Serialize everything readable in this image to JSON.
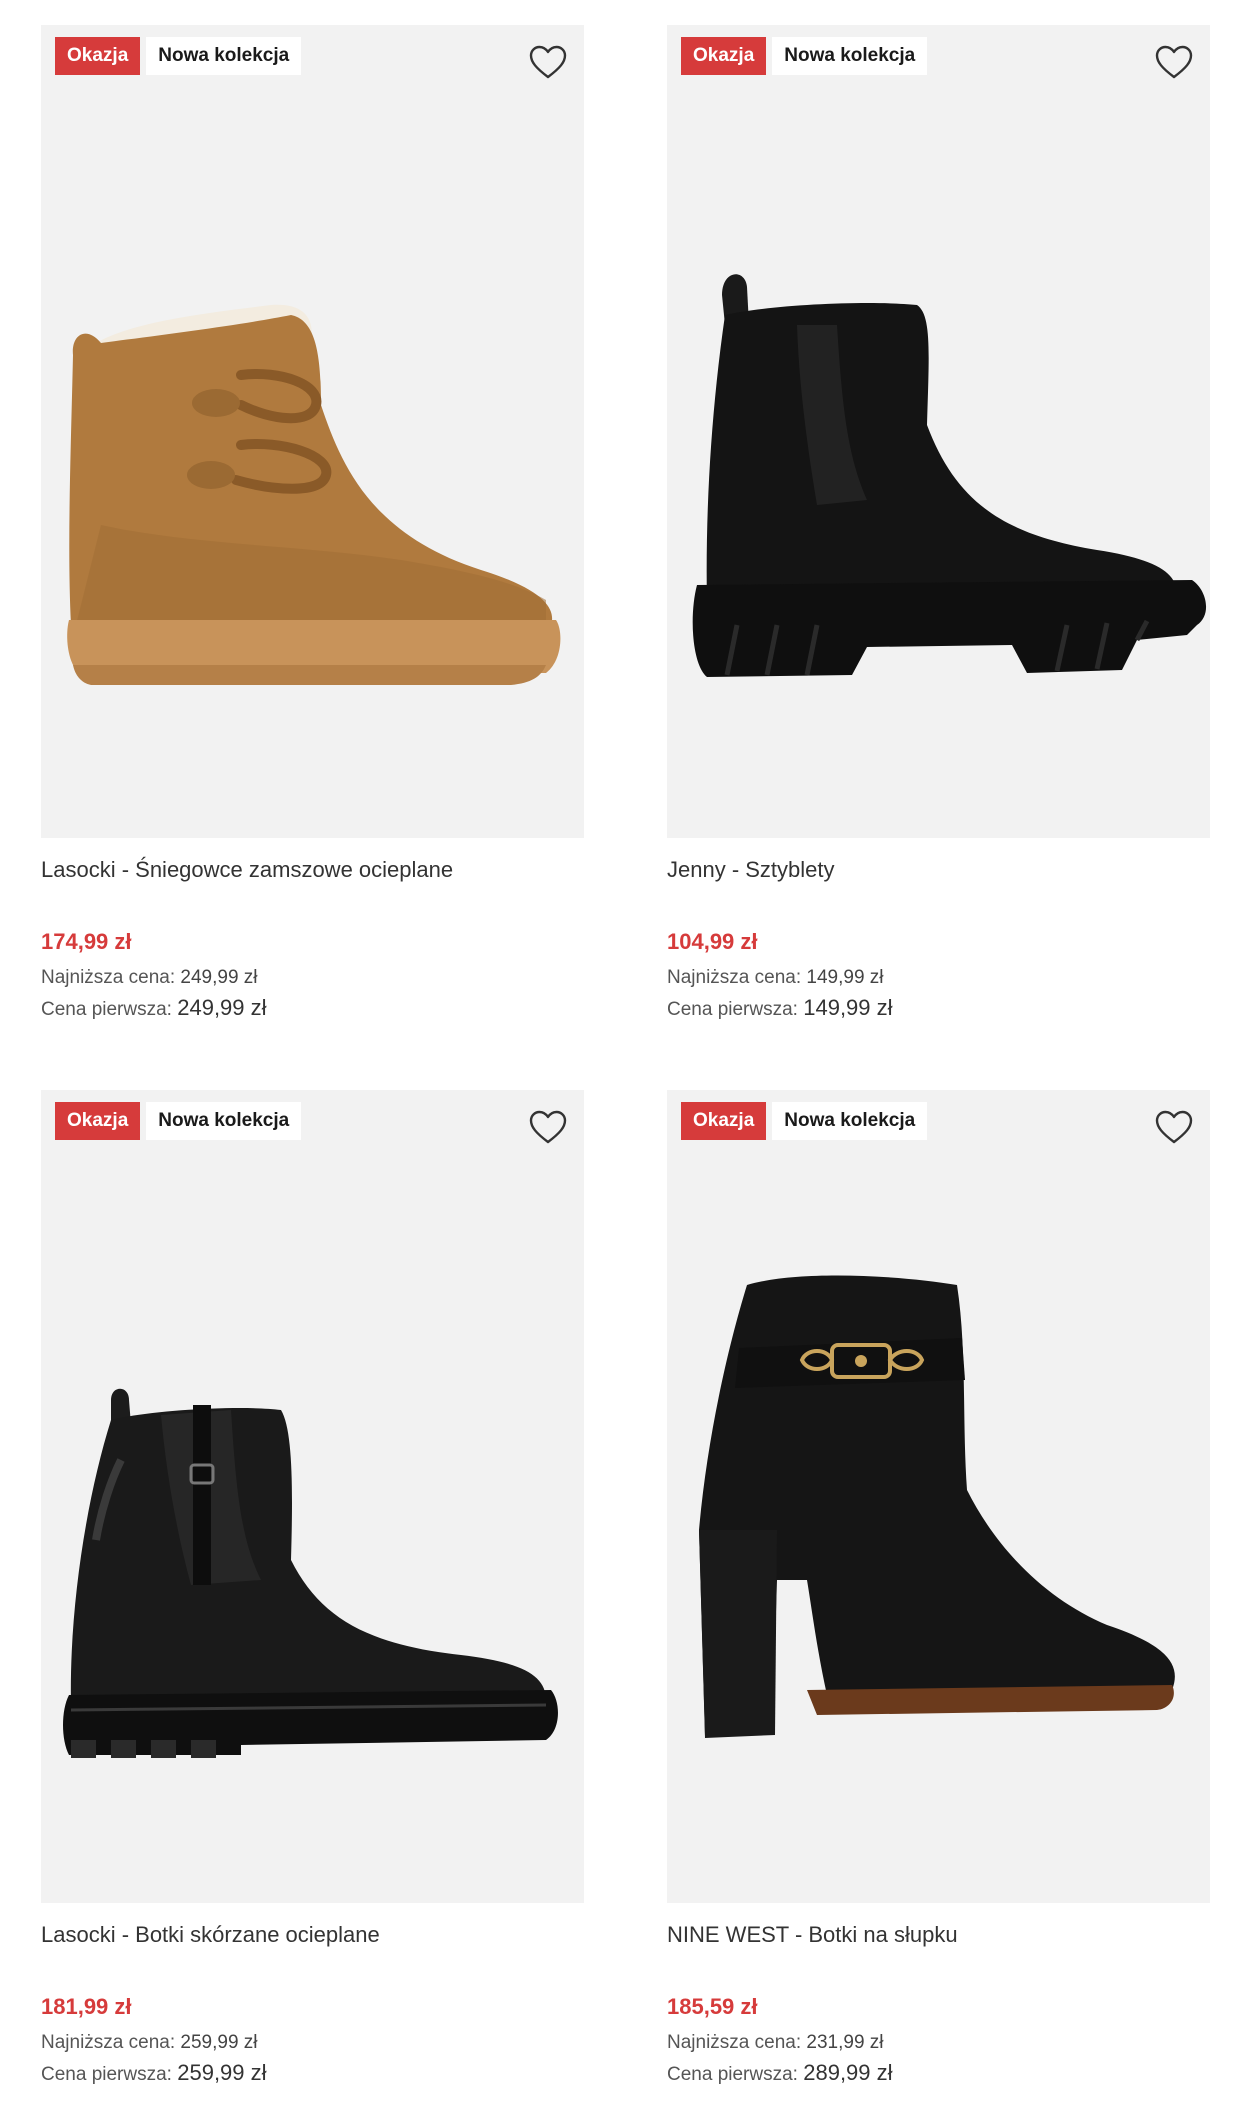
{
  "products": [
    {
      "badge_deal": "Okazja",
      "badge_new": "Nowa kolekcja",
      "title": "Lasocki - Śniegowce zamszowe ocieplane",
      "price": "174,99 zł",
      "lowest_label": "Najniższa cena:",
      "lowest_value": "249,99 zł",
      "first_label": "Cena pierwsza:",
      "first_value": "249,99 zł",
      "image": "tan-suede-snow-boot"
    },
    {
      "badge_deal": "Okazja",
      "badge_new": "Nowa kolekcja",
      "title": "Jenny - Sztyblety",
      "price": "104,99 zł",
      "lowest_label": "Najniższa cena:",
      "lowest_value": "149,99 zł",
      "first_label": "Cena pierwsza:",
      "first_value": "149,99 zł",
      "image": "black-chelsea-boot-lug-sole"
    },
    {
      "badge_deal": "Okazja",
      "badge_new": "Nowa kolekcja",
      "title": "Lasocki - Botki skórzane ocieplane",
      "price": "181,99 zł",
      "lowest_label": "Najniższa cena:",
      "lowest_value": "259,99 zł",
      "first_label": "Cena pierwsza:",
      "first_value": "259,99 zł",
      "image": "black-leather-chelsea-boot"
    },
    {
      "badge_deal": "Okazja",
      "badge_new": "Nowa kolekcja",
      "title": "NINE WEST - Botki na słupku",
      "price": "185,59 zł",
      "lowest_label": "Najniższa cena:",
      "lowest_value": "231,99 zł",
      "first_label": "Cena pierwsza:",
      "first_value": "289,99 zł",
      "image": "black-suede-block-heel-boot"
    }
  ],
  "colors": {
    "deal_badge": "#d63b3b",
    "price": "#d63b3b",
    "image_bg": "#f2f2f2"
  },
  "icons": {
    "favorite": "heart-outline-icon"
  }
}
